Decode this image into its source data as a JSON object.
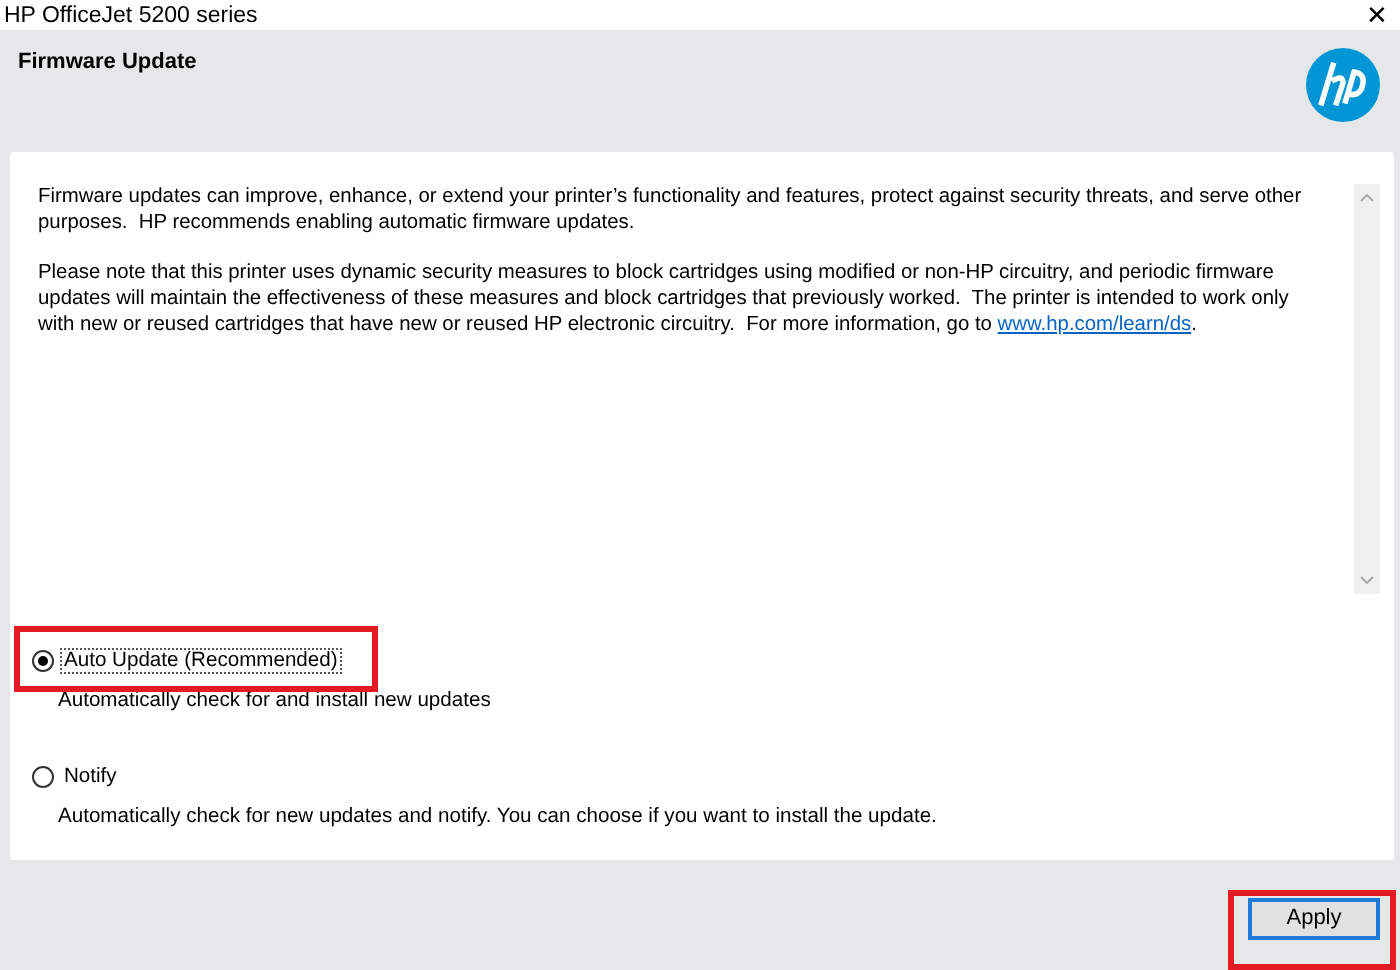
{
  "window": {
    "title": "HP OfficeJet 5200 series",
    "close": "✕"
  },
  "header": {
    "title": "Firmware Update"
  },
  "content": {
    "paragraphs": [
      {
        "text": "Firmware updates can improve, enhance, or extend your printer’s functionality and features, protect against security threats, and serve other purposes.  HP recommends enabling automatic firmware updates."
      },
      {
        "text": "Please note that this printer uses dynamic security measures to block cartridges using modified or non-HP circuitry, and periodic firmware updates will maintain the effectiveness of these measures and block cartridges that previously worked.  The printer is intended to work only with new or reused cartridges that have new or reused HP electronic circuitry.  For more information, go to ",
        "link": "www.hp.com/learn/ds",
        "after": "."
      }
    ]
  },
  "options": [
    {
      "label": "Auto Update (Recommended)",
      "description": "Automatically check for and install new updates",
      "selected": true,
      "highlighted": true
    },
    {
      "label": "Notify",
      "description": "Automatically check for new updates and notify. You can choose if you want to install the update.",
      "selected": false,
      "highlighted": false
    }
  ],
  "buttons": [
    {
      "label": "Apply",
      "highlighted": true
    }
  ]
}
